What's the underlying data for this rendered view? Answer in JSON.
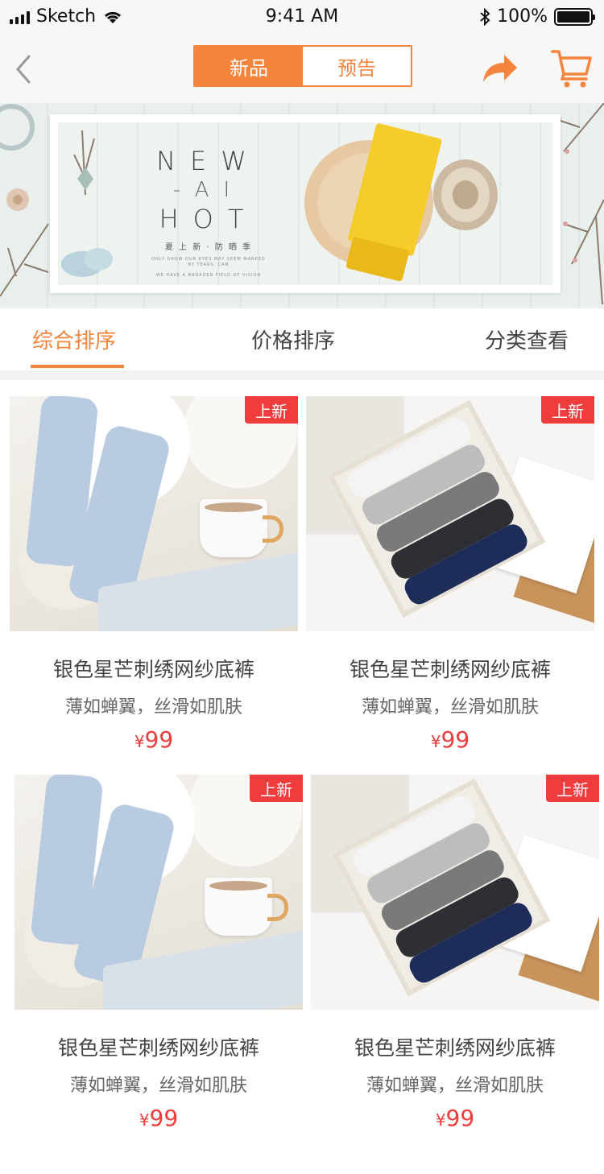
{
  "status_bar": {
    "carrier": "Sketch",
    "time": "9:41 AM",
    "battery": "100%"
  },
  "nav": {
    "segments": [
      {
        "label": "新品",
        "active": true
      },
      {
        "label": "预告",
        "active": false
      }
    ],
    "icons": {
      "back": "back-chevron-icon",
      "share": "share-icon",
      "cart": "cart-icon"
    }
  },
  "banner": {
    "line1": "NEW",
    "line2": "-AI",
    "line3": "HOT",
    "subtitle": "夏 上 新 · 防 晒 季",
    "tiny_line1": "ONLY SHOW OUR EYES MAY SEEM MARKED BY TEARS, CAN",
    "tiny_line2": "WE HAVE A BROADER FIELD OF VISION"
  },
  "filters": [
    {
      "label": "综合排序",
      "active": true
    },
    {
      "label": "价格排序",
      "active": false
    },
    {
      "label": "分类查看",
      "active": false
    }
  ],
  "products": [
    {
      "badge": "上新",
      "title": "银色星芒刺绣网纱底裤",
      "desc": "薄如蝉翼，丝滑如肌肤",
      "currency": "¥",
      "price": "99",
      "image": "socks-photo"
    },
    {
      "badge": "上新",
      "title": "银色星芒刺绣网纱底裤",
      "desc": "薄如蝉翼，丝滑如肌肤",
      "currency": "¥",
      "price": "99",
      "image": "sock-box-photo"
    },
    {
      "badge": "上新",
      "title": "银色星芒刺绣网纱底裤",
      "desc": "薄如蝉翼，丝滑如肌肤",
      "currency": "¥",
      "price": "99",
      "image": "socks-photo"
    },
    {
      "badge": "上新",
      "title": "银色星芒刺绣网纱底裤",
      "desc": "薄如蝉翼，丝滑如肌肤",
      "currency": "¥",
      "price": "99",
      "image": "sock-box-photo"
    }
  ],
  "colors": {
    "accent": "#f5843c",
    "badge": "#f03c3c",
    "price": "#f03c3c"
  }
}
